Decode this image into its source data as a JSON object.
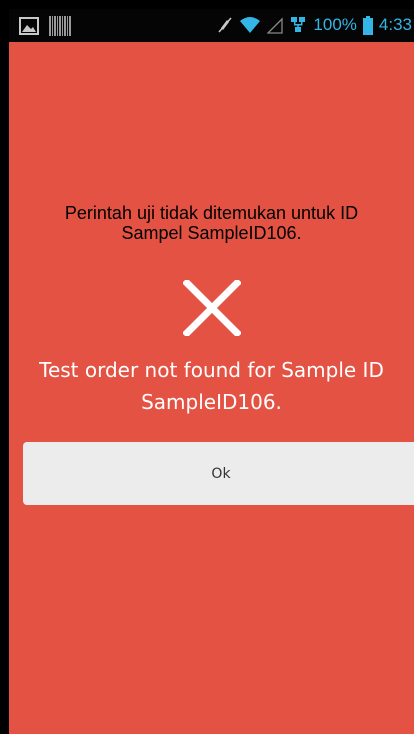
{
  "status_bar": {
    "battery_percent": "100%",
    "time": "4:33",
    "icons": [
      "gallery-icon",
      "barcode-icon",
      "mute-icon",
      "wifi-icon",
      "signal-icon",
      "network-icon",
      "battery-icon"
    ],
    "accent_color": "#33b5e5"
  },
  "dialog": {
    "background_color": "#e35243",
    "message_local": "Perintah uji tidak ditemukan untuk ID Sampel SampleID106.",
    "icon": "close-icon",
    "message_en": "Test order not found for Sample ID SampleID106.",
    "ok_label": "Ok"
  }
}
